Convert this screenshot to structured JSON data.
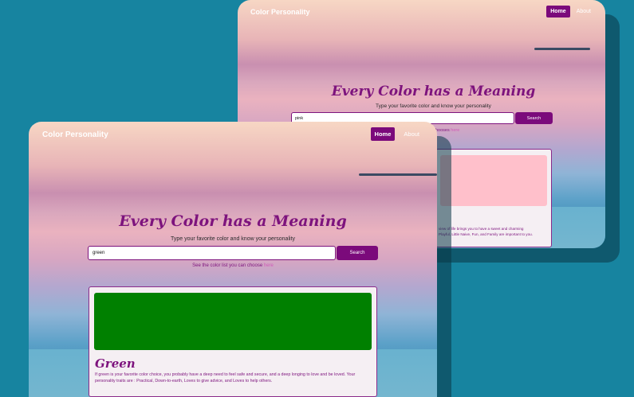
{
  "back": {
    "brand": "Color Personality",
    "nav": {
      "home": "Home",
      "about": "About"
    },
    "headline": "Every Color has a Meaning",
    "subtitle": "Type your favorite color and know your personality",
    "search": {
      "value": "pink",
      "button": "Search"
    },
    "hint_partial": "hooses",
    "hint_link": "here",
    "swatch_color": "#ffc0cb",
    "desc_partial_1": "view of life brings you to have a sweet and charming",
    "desc_partial_2": "Playful, Little Naive, Fun, and Family are important to you."
  },
  "front": {
    "brand": "Color Personality",
    "nav": {
      "home": "Home",
      "about": "About"
    },
    "headline": "Every Color has a Meaning",
    "subtitle": "Type your favorite color and know your personality",
    "search": {
      "value": "green",
      "button": "Search"
    },
    "hint_text": "See the color list you can choose",
    "hint_link": "here",
    "swatch_color": "#008000",
    "color_name": "Green",
    "description": "If green is your favorite color choice, you probably have a deep need to feel safe and secure, and a deep longing to love and be loved. Your personality traits are : Practical, Down-to-earth, Loves to give advice, and Loves to help others."
  },
  "colors": {
    "background": "#1784a0",
    "accent": "#7b0a7b"
  }
}
